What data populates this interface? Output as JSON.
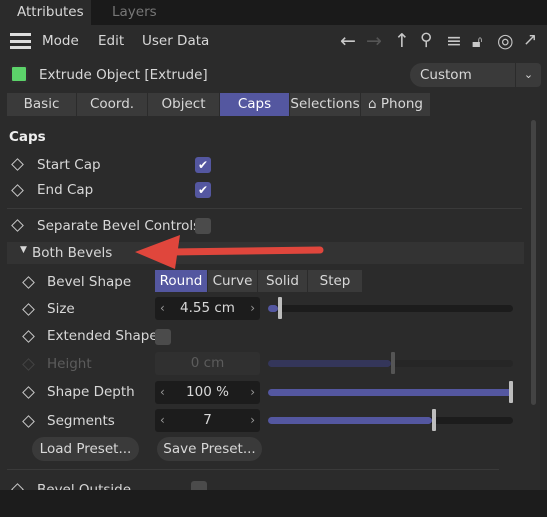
{
  "tabs": [
    "Attributes",
    "Layers"
  ],
  "menu": [
    "Mode",
    "Edit",
    "User Data"
  ],
  "toolbar_icons": [
    "back-arrow-icon",
    "forward-arrow-icon",
    "up-arrow-icon",
    "search-icon",
    "filter-icon",
    "lock-icon",
    "target-icon",
    "open-window-icon"
  ],
  "object_title": "Extrude Object [Extrude]",
  "mode_select": "Custom",
  "panel_tabs": [
    "Basic",
    "Coord.",
    "Object",
    "Caps",
    "Selections",
    "⌂ Phong"
  ],
  "active_tab": "Caps",
  "section": "Caps",
  "start_cap": {
    "label": "Start Cap",
    "checked": true
  },
  "end_cap": {
    "label": "End Cap",
    "checked": true
  },
  "separate": {
    "label": "Separate Bevel Controls",
    "checked": false
  },
  "group": "Both Bevels",
  "bevel_shape": {
    "label": "Bevel Shape",
    "options": [
      "Round",
      "Curve",
      "Solid",
      "Step"
    ],
    "selected": "Round"
  },
  "size": {
    "label": "Size",
    "value": "4.55 cm",
    "slider": 0.04
  },
  "extended": {
    "label": "Extended Shape",
    "checked": false
  },
  "height": {
    "label": "Height",
    "value": "0 cm",
    "slider": 0.5,
    "disabled": true
  },
  "depth": {
    "label": "Shape Depth",
    "value": "100 %",
    "slider": 1.0
  },
  "segments": {
    "label": "Segments",
    "value": "7",
    "slider": 0.67
  },
  "load_preset": "Load Preset...",
  "save_preset": "Save Preset...",
  "bevel_outside": "Bevel Outside",
  "colors": {
    "accent": "#5457a0",
    "arrow": "#e0463c",
    "panel": "#2b2b2b"
  }
}
